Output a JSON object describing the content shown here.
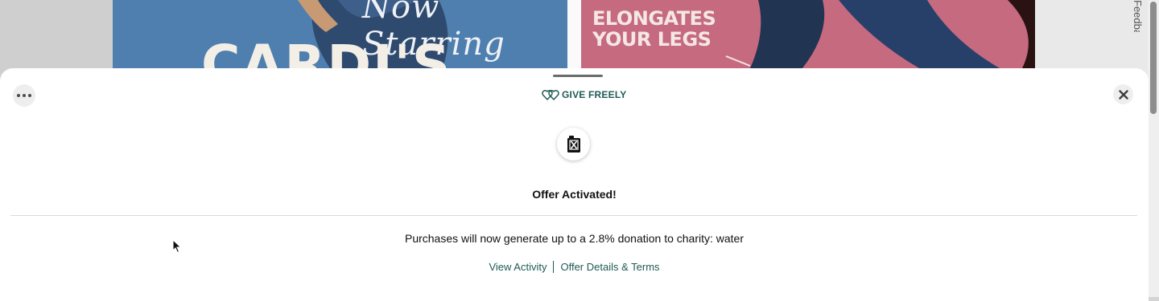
{
  "background": {
    "promo_left_cursive": "Now Starring",
    "promo_left_headline": "CARDI'S",
    "promo_right_headline": "ELONGATES YOUR LEGS",
    "feedback_tab": "Feedback"
  },
  "modal": {
    "brand": {
      "label": "GIVE FREELY",
      "icon": "hearts-icon",
      "color": "#1f5b55"
    },
    "more_menu_icon": "more-horizontal-icon",
    "close_icon": "close-icon",
    "charity_logo_icon": "jerrycan-icon",
    "title": "Offer Activated!",
    "message": "Purchases will now generate up to a 2.8% donation to charity: water",
    "links": {
      "view_activity": "View Activity",
      "offer_details": "Offer Details & Terms"
    }
  }
}
